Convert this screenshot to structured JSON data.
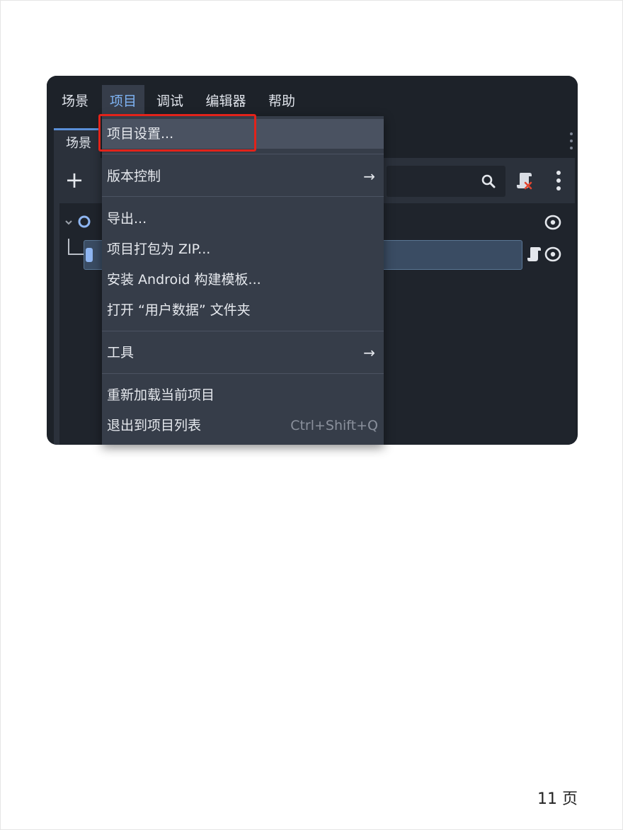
{
  "menubar": {
    "items": [
      {
        "label": "场景"
      },
      {
        "label": "项目"
      },
      {
        "label": "调试"
      },
      {
        "label": "编辑器"
      },
      {
        "label": "帮助"
      }
    ],
    "active_color": "#7fb4f5"
  },
  "dock": {
    "tab_label": "场景"
  },
  "scene_panel": {
    "add_icon": "+",
    "filter_icon": "search-icon",
    "root_expander": "⌄",
    "root_node_icon": "circle-node-icon",
    "child_connector": "└─"
  },
  "dropdown": {
    "items": [
      {
        "label": "项目设置..."
      },
      {
        "label": "版本控制",
        "arrow": "→"
      },
      {
        "label": "导出..."
      },
      {
        "label": "项目打包为 ZIP..."
      },
      {
        "label": "安装 Android 构建模板..."
      },
      {
        "label": "打开 “用户数据” 文件夹"
      },
      {
        "label": "工具",
        "arrow": "→"
      },
      {
        "label": "重新加载当前项目"
      },
      {
        "label": "退出到项目列表",
        "shortcut": "Ctrl+Shift+Q"
      }
    ]
  },
  "highlight_color": "#e2231a",
  "footer": {
    "page_number": "11 页"
  }
}
